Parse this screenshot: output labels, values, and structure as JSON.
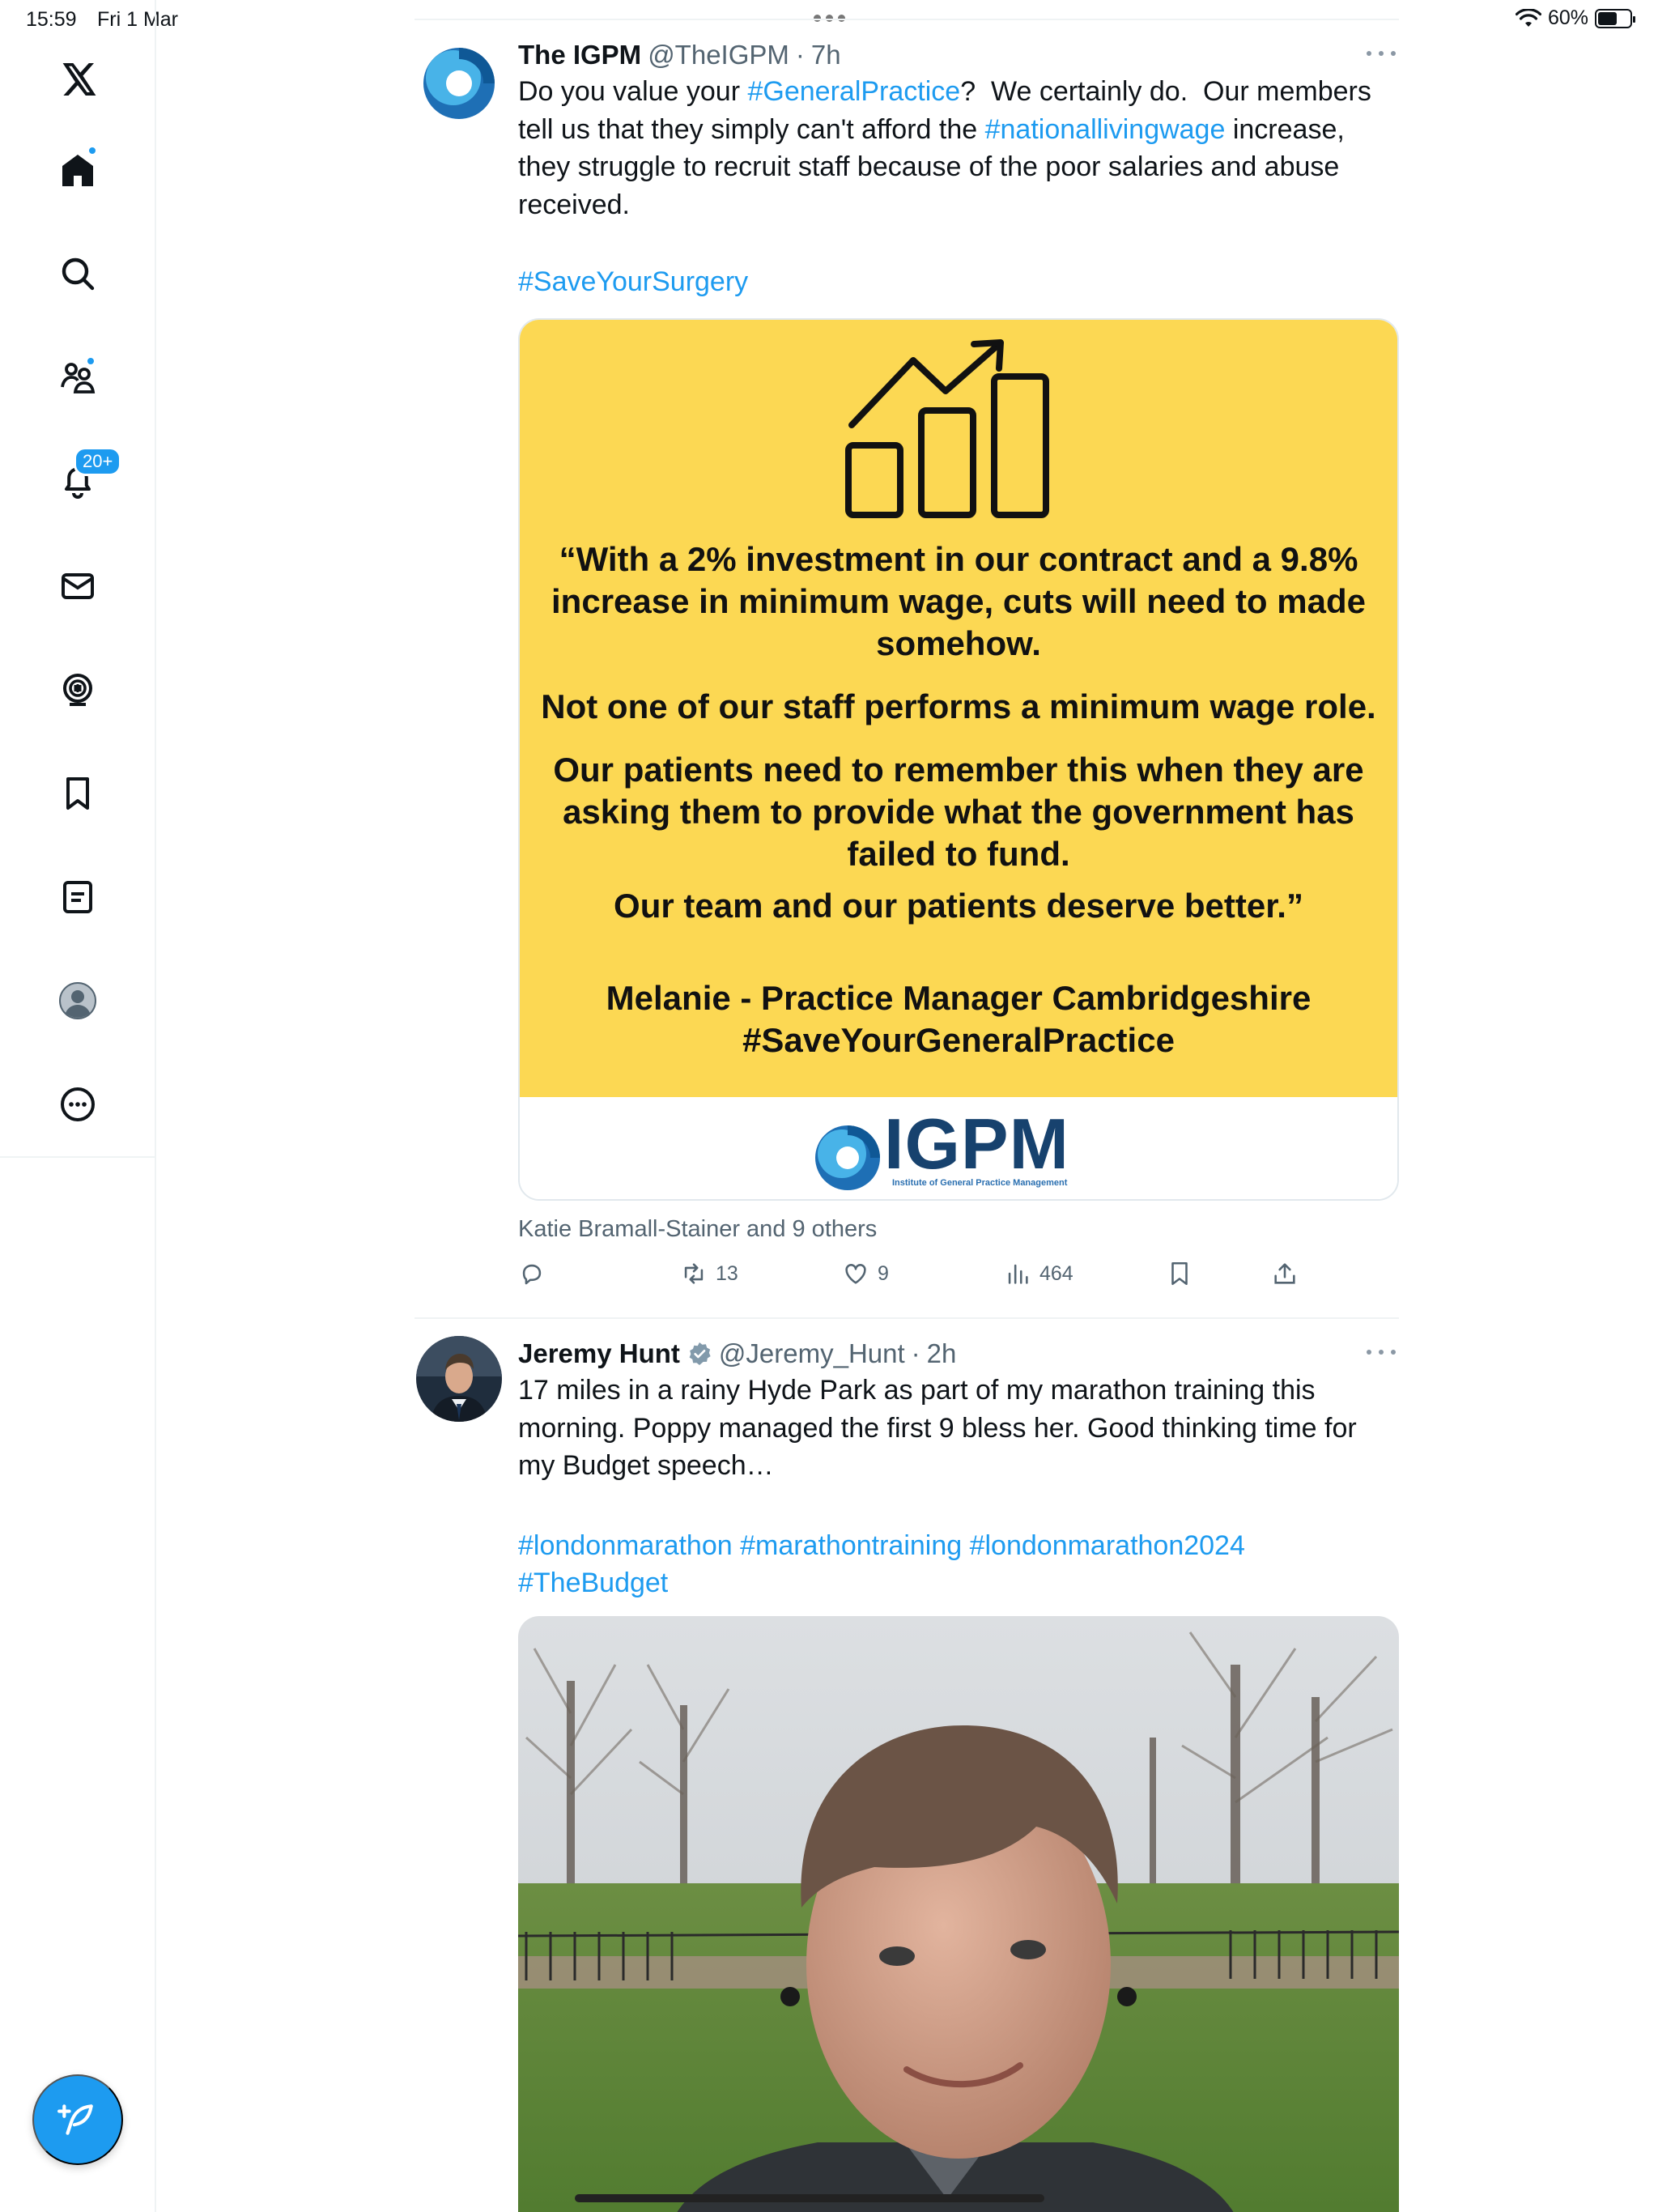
{
  "status_bar": {
    "time": "15:59",
    "date": "Fri 1 Mar",
    "battery": "60%",
    "battery_level": 0.6
  },
  "sidebar": {
    "items": [
      "x-logo",
      "home",
      "search",
      "communities",
      "notifications",
      "messages",
      "spaces",
      "bookmarks",
      "lists",
      "profile",
      "more"
    ],
    "notifications_badge": "20+",
    "accent_color": "#1d9bf0"
  },
  "tweets": [
    {
      "author": "The IGPM",
      "handle": "@TheIGPM",
      "separator": "·",
      "time": "7h",
      "text_parts": [
        {
          "t": "Do you value your ",
          "tag": false
        },
        {
          "t": "#GeneralPractice",
          "tag": true
        },
        {
          "t": "?  We certainly do.  Our members tell us that they simply can't afford the ",
          "tag": false
        },
        {
          "t": "#nationallivingwage",
          "tag": true
        },
        {
          "t": " increase, they struggle to recruit staff because of the poor salaries and abuse received.",
          "tag": false
        }
      ],
      "hashtag_line": "#SaveYourSurgery",
      "card": {
        "quote_lines_1": [
          "“With a 2% investment in our contract and a 9.8%",
          "increase in minimum wage, cuts will need to made",
          "somehow."
        ],
        "quote_line_2": "Not one of our staff performs a minimum wage role.",
        "quote_lines_3": [
          "Our patients need to remember this when they are",
          "asking them to provide what the government has",
          "failed to fund."
        ],
        "quote_line_4": "Our team and our patients deserve better.”",
        "attribution": [
          "Melanie - Practice Manager Cambridgeshire",
          "#SaveYourGeneralPractice"
        ],
        "logo_text": "IGPM",
        "logo_subtitle": "Institute of General Practice Management"
      },
      "social_context": "Katie Bramall-Stainer and 9 others",
      "actions": {
        "replies": "",
        "reposts": "13",
        "likes": "9",
        "views": "464"
      }
    },
    {
      "author": "Jeremy Hunt",
      "verified": true,
      "handle": "@Jeremy_Hunt",
      "separator": "·",
      "time": "2h",
      "text": "17 miles in a rainy Hyde Park as part of my marathon training this morning. Poppy managed the first 9 bless her. Good thinking time for my Budget speech…",
      "hashtags_line1": "#londonmarathon #marathontraining #londonmarathon2024",
      "hashtags_line2": "#TheBudget"
    }
  ]
}
